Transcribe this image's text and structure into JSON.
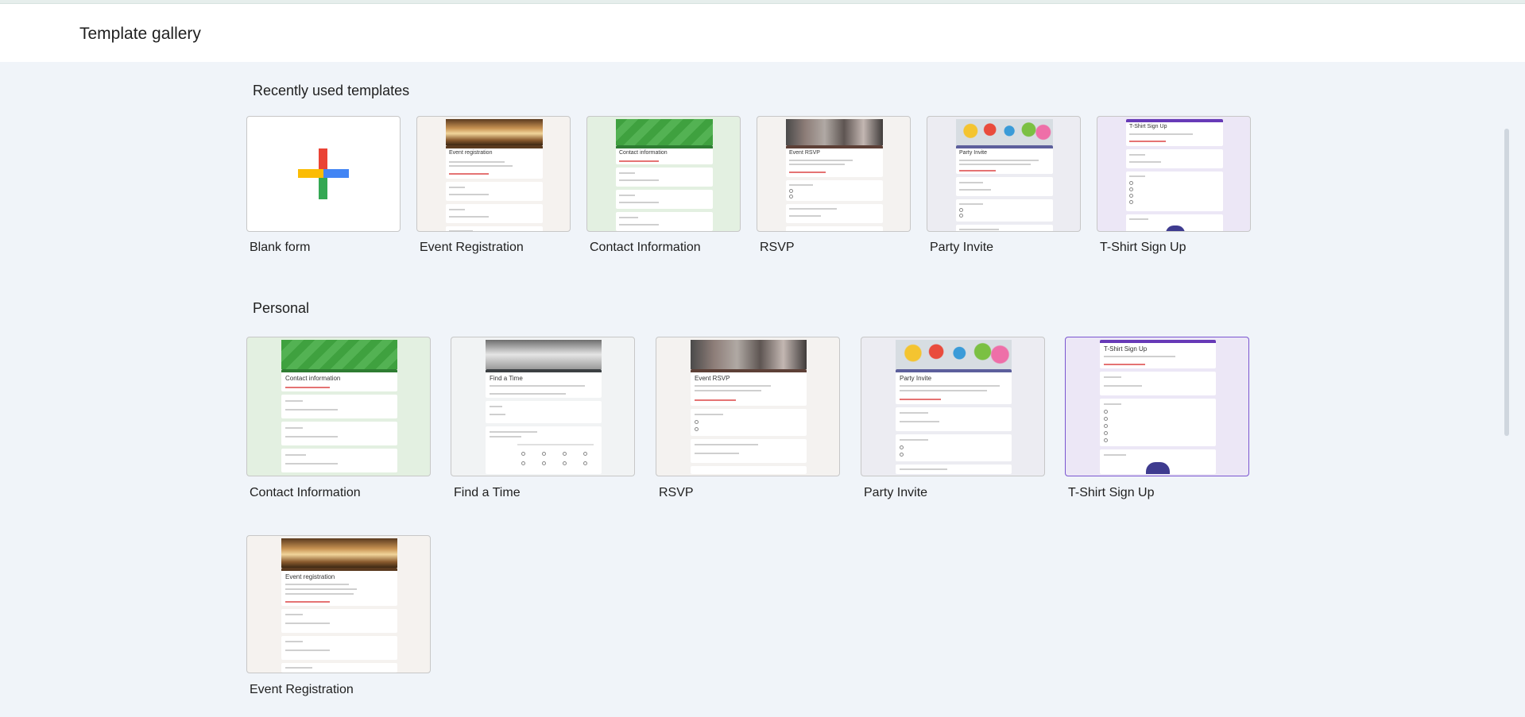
{
  "header": {
    "title": "Template gallery"
  },
  "sections": {
    "recent": {
      "title": "Recently used templates",
      "cards": [
        {
          "label": "Blank form"
        },
        {
          "label": "Event Registration",
          "preview_title": "Event registration"
        },
        {
          "label": "Contact Information",
          "preview_title": "Contact information"
        },
        {
          "label": "RSVP",
          "preview_title": "Event RSVP"
        },
        {
          "label": "Party Invite",
          "preview_title": "Party Invite"
        },
        {
          "label": "T-Shirt Sign Up",
          "preview_title": "T-Shirt Sign Up"
        }
      ]
    },
    "personal": {
      "title": "Personal",
      "cards": [
        {
          "label": "Contact Information",
          "preview_title": "Contact information"
        },
        {
          "label": "Find a Time",
          "preview_title": "Find a Time"
        },
        {
          "label": "RSVP",
          "preview_title": "Event RSVP"
        },
        {
          "label": "Party Invite",
          "preview_title": "Party Invite"
        },
        {
          "label": "T-Shirt Sign Up",
          "preview_title": "T-Shirt Sign Up"
        },
        {
          "label": "Event Registration",
          "preview_title": "Event registration"
        }
      ]
    }
  },
  "colors": {
    "event": "#f5f2ef",
    "contact": "#e3f0e1",
    "rsvp": "#f4f2f0",
    "party": "#ececf2",
    "tshirt": "#ece7f6",
    "findtime": "#f1f3f4",
    "selected_border": "#7a55d0"
  }
}
